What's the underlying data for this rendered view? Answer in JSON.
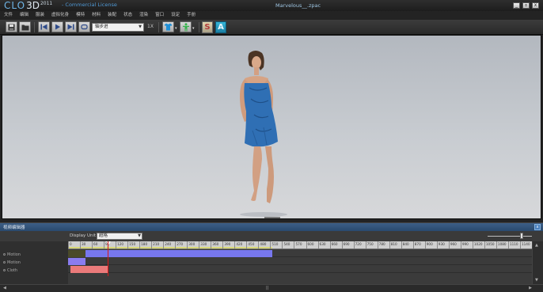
{
  "app": {
    "logo_clo": "CLO",
    "logo_3d": "3D",
    "logo_year": "2011",
    "license": "- Commercial License",
    "filename": "Marvelous__.zpac"
  },
  "window_controls": {
    "minimize": "_",
    "restore": "▫",
    "close": "x"
  },
  "menu": [
    "文件",
    "编辑",
    "服装",
    "虚拟化身",
    "模特",
    "材料",
    "装配",
    "状态",
    "渲染",
    "窗口",
    "设定",
    "手册"
  ],
  "toolbar": {
    "speed_value": "轴步进",
    "speed_label": "1X",
    "s_label": "S",
    "a_label": "A",
    "colors": {
      "shirt_icon": "#1f8fd6",
      "avatar_icon": "#33b34a",
      "a_button": "#2aa3c9"
    }
  },
  "animation_editor": {
    "title": "视频编辑器",
    "display_unit_label": "Display Unit",
    "display_unit_value": "超格",
    "tracks": [
      "Motion",
      "Motion",
      "Cloth"
    ],
    "ruler_ticks": [
      "0",
      "30",
      "60",
      "90",
      "120",
      "150",
      "180",
      "210",
      "240",
      "270",
      "300",
      "330",
      "360",
      "390",
      "420",
      "450",
      "480",
      "510",
      "540",
      "570",
      "600",
      "630",
      "660",
      "690",
      "720",
      "750",
      "780",
      "810",
      "840",
      "870",
      "900",
      "930",
      "960",
      "990",
      "1020",
      "1050",
      "1080",
      "1110",
      "1140"
    ],
    "colors": {
      "motion1_bar": "#7777ee",
      "motion1_dark": "#4a4a2a",
      "motion2_bar": "#8a7cf0",
      "cloth_bar": "#ea7a7a",
      "playhead": "#d81818",
      "ruler_highlight": "#d8d87a"
    }
  }
}
